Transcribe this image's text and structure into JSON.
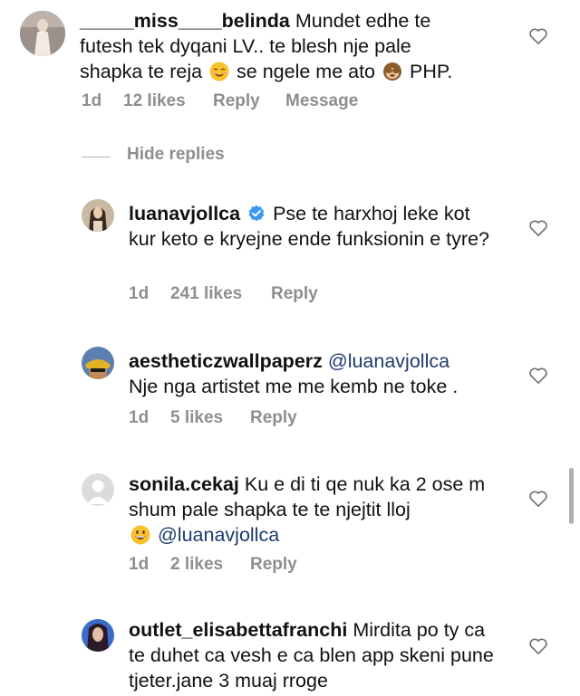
{
  "comments": [
    {
      "username": "_____miss____belinda",
      "text_parts": [
        "Mundet edhe te futesh tek dyqani LV.. te blesh nje pale shapka te reja",
        "se ngele me ato",
        "PHP."
      ],
      "time": "1d",
      "likes": "12 likes",
      "reply": "Reply",
      "message": "Message"
    },
    {
      "username": "luanavjollca",
      "text": "Pse te harxhoj leke kot kur keto e kryejne ende funksionin e tyre?",
      "time": "1d",
      "likes": "241 likes",
      "reply": "Reply"
    },
    {
      "username": "aestheticzwallpaperz",
      "mention": "@luanavjollca",
      "text": "Nje nga artistet me me kemb ne toke .",
      "time": "1d",
      "likes": "5 likes",
      "reply": "Reply"
    },
    {
      "username": "sonila.cekaj",
      "text": "Ku e di ti qe nuk ka 2 ose m shum pale shapka te te njejtit lloj",
      "mention": "@luanavjollca",
      "time": "1d",
      "likes": "2 likes",
      "reply": "Reply"
    },
    {
      "username": "outlet_elisabettafranchi",
      "text": "Mirdita po ty ca te duhet ca vesh e ca blen app skeni pune tjeter.jane 3 muaj rroge"
    }
  ],
  "hide_replies": "Hide replies",
  "icons": {
    "heart": "heart-outline-icon",
    "verified": "verified-badge-icon",
    "relieved": "relieved-face-emoji",
    "monkey": "see-no-evil-monkey-emoji",
    "grin": "grinning-face-emoji"
  },
  "colors": {
    "meta": "#8e8e8e",
    "verified": "#3897f0",
    "mention": "#1f3b6e"
  }
}
